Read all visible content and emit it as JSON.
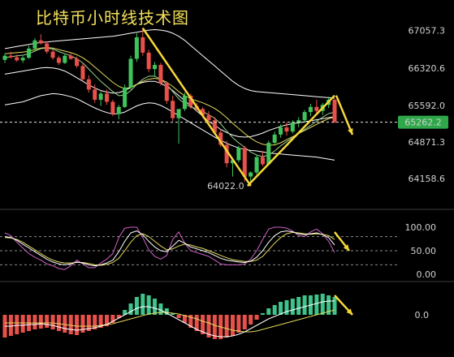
{
  "title": "比特币小时线技术图",
  "chart_data": {
    "type": "candlestick",
    "title": "比特币小时线技术图",
    "y_ticks": [
      67057.3,
      66320.6,
      65592.0,
      64871.3,
      64158.6
    ],
    "y_tick_labels": [
      "67057.3",
      "66320.6",
      "65592.0",
      "64871.3",
      "64158.6"
    ],
    "ylim": [
      63940,
      67300
    ],
    "current_price": 65262.2,
    "current_price_label": "65262.2",
    "low_annotation": {
      "value": 64022.0,
      "label": "64022.0",
      "index": 41
    },
    "candles": [
      [
        66480,
        66600,
        66420,
        66560
      ],
      [
        66560,
        66640,
        66500,
        66530
      ],
      [
        66530,
        66580,
        66440,
        66470
      ],
      [
        66470,
        66550,
        66420,
        66520
      ],
      [
        66520,
        66760,
        66500,
        66700
      ],
      [
        66700,
        66900,
        66660,
        66860
      ],
      [
        66860,
        66980,
        66780,
        66800
      ],
      [
        66800,
        66840,
        66600,
        66640
      ],
      [
        66640,
        66680,
        66480,
        66520
      ],
      [
        66520,
        66560,
        66380,
        66420
      ],
      [
        66420,
        66600,
        66400,
        66560
      ],
      [
        66560,
        66620,
        66480,
        66500
      ],
      [
        66500,
        66540,
        66320,
        66360
      ],
      [
        66360,
        66420,
        66060,
        66100
      ],
      [
        66100,
        66180,
        65840,
        65900
      ],
      [
        65900,
        66000,
        65640,
        65700
      ],
      [
        65700,
        65860,
        65580,
        65820
      ],
      [
        65820,
        65900,
        65600,
        65660
      ],
      [
        65660,
        65700,
        65380,
        65420
      ],
      [
        65420,
        65600,
        65320,
        65560
      ],
      [
        65560,
        66000,
        65540,
        65940
      ],
      [
        65940,
        66560,
        65900,
        66500
      ],
      [
        66500,
        67000,
        66440,
        66920
      ],
      [
        66920,
        67100,
        66560,
        66620
      ],
      [
        66620,
        66680,
        66240,
        66300
      ],
      [
        66300,
        66440,
        66160,
        66380
      ],
      [
        66380,
        66420,
        65980,
        66020
      ],
      [
        66020,
        66060,
        65620,
        65680
      ],
      [
        65680,
        65780,
        65280,
        65340
      ],
      [
        65340,
        65400,
        64840,
        65520
      ],
      [
        65520,
        65840,
        65480,
        65780
      ],
      [
        65780,
        65820,
        65520,
        65580
      ],
      [
        65580,
        65640,
        65460,
        65520
      ],
      [
        65520,
        65560,
        65340,
        65400
      ],
      [
        65400,
        65480,
        65240,
        65300
      ],
      [
        65300,
        65360,
        65020,
        65060
      ],
      [
        65060,
        65120,
        64780,
        64820
      ],
      [
        64820,
        64900,
        64380,
        64460
      ],
      [
        64460,
        64560,
        64200,
        64520
      ],
      [
        64520,
        64800,
        64480,
        64760
      ],
      [
        64760,
        64800,
        64100,
        64200
      ],
      [
        64200,
        64300,
        64022,
        64280
      ],
      [
        64280,
        64620,
        64240,
        64580
      ],
      [
        64580,
        64700,
        64400,
        64440
      ],
      [
        64440,
        64900,
        64420,
        64860
      ],
      [
        64860,
        65080,
        64800,
        65020
      ],
      [
        65020,
        65220,
        64960,
        65160
      ],
      [
        65160,
        65260,
        65000,
        65080
      ],
      [
        65080,
        65300,
        65040,
        65260
      ],
      [
        65260,
        65360,
        65160,
        65300
      ],
      [
        65300,
        65500,
        65260,
        65460
      ],
      [
        65460,
        65620,
        65380,
        65560
      ],
      [
        65560,
        65700,
        65420,
        65480
      ],
      [
        65480,
        65640,
        65400,
        65600
      ],
      [
        65600,
        65760,
        65540,
        65700
      ],
      [
        65700,
        65720,
        65240,
        65262.2
      ]
    ],
    "ma_series": [
      {
        "color": "#ffffff",
        "values": [
          66700,
          66720,
          66740,
          66760,
          66780,
          66800,
          66820,
          66830,
          66840,
          66850,
          66860,
          66870,
          66880,
          66890,
          66900,
          66910,
          66920,
          66930,
          66940,
          66960,
          66980,
          67000,
          67020,
          67040,
          67060,
          67070,
          67060,
          67040,
          67000,
          66940,
          66860,
          66760,
          66660,
          66560,
          66460,
          66360,
          66260,
          66160,
          66060,
          65980,
          65920,
          65880,
          65860,
          65850,
          65840,
          65830,
          65820,
          65810,
          65800,
          65790,
          65780,
          65770,
          65760,
          65750,
          65740,
          65730
        ]
      },
      {
        "color": "#ffffff",
        "values": [
          66200,
          66220,
          66240,
          66260,
          66280,
          66300,
          66320,
          66330,
          66320,
          66300,
          66260,
          66200,
          66130,
          66060,
          65990,
          65930,
          65880,
          65850,
          65830,
          65840,
          65880,
          65940,
          66000,
          66040,
          66060,
          66060,
          66020,
          65960,
          65880,
          65780,
          65680,
          65580,
          65480,
          65380,
          65280,
          65200,
          65120,
          65060,
          65010,
          64980,
          64970,
          64980,
          65010,
          65050,
          65100,
          65140,
          65180,
          65210,
          65230,
          65250,
          65270,
          65290,
          65310,
          65330,
          65350,
          65370
        ]
      },
      {
        "color": "#ffffff",
        "values": [
          65600,
          65620,
          65640,
          65660,
          65700,
          65740,
          65780,
          65800,
          65820,
          65810,
          65790,
          65760,
          65720,
          65660,
          65600,
          65540,
          65490,
          65450,
          65420,
          65430,
          65460,
          65520,
          65580,
          65620,
          65640,
          65630,
          65590,
          65530,
          65460,
          65390,
          65320,
          65250,
          65180,
          65110,
          65040,
          64970,
          64910,
          64850,
          64800,
          64760,
          64730,
          64710,
          64700,
          64680,
          64660,
          64650,
          64640,
          64630,
          64620,
          64610,
          64600,
          64590,
          64580,
          64560,
          64540,
          64520
        ]
      },
      {
        "color": "#9bd38f",
        "values": [
          66520,
          66540,
          66560,
          66570,
          66600,
          66650,
          66700,
          66710,
          66690,
          66640,
          66600,
          66560,
          66500,
          66420,
          66300,
          66180,
          66060,
          65960,
          65860,
          65780,
          65790,
          65880,
          66000,
          66100,
          66160,
          66160,
          66100,
          66000,
          65860,
          65720,
          65620,
          65560,
          65520,
          65470,
          65410,
          65340,
          65230,
          65090,
          64960,
          64860,
          64770,
          64680,
          64620,
          64590,
          64620,
          64700,
          64800,
          64880,
          64960,
          65040,
          65120,
          65200,
          65280,
          65360,
          65430,
          65460
        ]
      },
      {
        "color": "#e3d95a",
        "values": [
          66600,
          66610,
          66620,
          66630,
          66650,
          66680,
          66710,
          66720,
          66710,
          66680,
          66650,
          66620,
          66580,
          66520,
          66440,
          66340,
          66240,
          66140,
          66040,
          65960,
          65920,
          65940,
          66000,
          66060,
          66100,
          66120,
          66100,
          66040,
          65960,
          65860,
          65780,
          65720,
          65680,
          65640,
          65590,
          65530,
          65450,
          65350,
          65240,
          65140,
          65040,
          64950,
          64880,
          64830,
          64810,
          64820,
          64860,
          64920,
          64980,
          65040,
          65100,
          65160,
          65220,
          65280,
          65330,
          65360
        ]
      }
    ],
    "stoch": {
      "ylim": [
        0,
        100
      ],
      "ticks": [
        100.0,
        50.0,
        0.0
      ],
      "tick_labels": [
        "100.00",
        "50.00",
        "0.00"
      ],
      "levels": [
        80,
        50,
        20
      ],
      "k": [
        80,
        78,
        72,
        64,
        56,
        48,
        40,
        32,
        26,
        22,
        20,
        22,
        26,
        24,
        20,
        18,
        20,
        24,
        30,
        48,
        70,
        88,
        92,
        84,
        70,
        58,
        50,
        48,
        60,
        72,
        66,
        58,
        54,
        50,
        46,
        40,
        34,
        30,
        28,
        26,
        25,
        28,
        36,
        50,
        68,
        82,
        90,
        92,
        90,
        86,
        84,
        86,
        88,
        84,
        78,
        62
      ],
      "d": [
        78,
        77,
        74,
        68,
        60,
        52,
        44,
        36,
        30,
        26,
        24,
        24,
        25,
        25,
        23,
        20,
        19,
        21,
        25,
        34,
        50,
        68,
        82,
        86,
        80,
        70,
        60,
        52,
        54,
        60,
        64,
        62,
        58,
        55,
        50,
        45,
        40,
        35,
        31,
        29,
        27,
        27,
        30,
        38,
        52,
        66,
        78,
        86,
        89,
        88,
        86,
        85,
        86,
        85,
        82,
        74
      ],
      "j": [
        88,
        82,
        68,
        56,
        44,
        36,
        30,
        22,
        18,
        12,
        10,
        18,
        30,
        22,
        14,
        14,
        24,
        32,
        44,
        78,
        98,
        100,
        100,
        78,
        52,
        38,
        32,
        40,
        74,
        90,
        66,
        50,
        46,
        42,
        38,
        30,
        22,
        20,
        20,
        20,
        22,
        32,
        50,
        74,
        96,
        100,
        100,
        98,
        92,
        82,
        80,
        90,
        96,
        86,
        70,
        46
      ]
    },
    "macd": {
      "tick_labels": [
        "0.0"
      ],
      "histogram": [
        -28,
        -26,
        -24,
        -22,
        -20,
        -18,
        -17,
        -16,
        -18,
        -20,
        -22,
        -24,
        -25,
        -22,
        -20,
        -18,
        -16,
        -14,
        -10,
        -4,
        6,
        14,
        22,
        26,
        24,
        20,
        14,
        8,
        2,
        -4,
        -10,
        -16,
        -20,
        -24,
        -28,
        -30,
        -30,
        -28,
        -26,
        -22,
        -18,
        -12,
        -6,
        2,
        8,
        12,
        16,
        18,
        20,
        22,
        24,
        24,
        25,
        26,
        24,
        22
      ],
      "dif": [
        -14,
        -14,
        -13,
        -13,
        -12,
        -12,
        -11,
        -12,
        -13,
        -15,
        -17,
        -18,
        -19,
        -18,
        -17,
        -16,
        -14,
        -12,
        -8,
        -4,
        0,
        4,
        8,
        10,
        10,
        8,
        6,
        2,
        -2,
        -6,
        -10,
        -14,
        -18,
        -21,
        -24,
        -26,
        -27,
        -27,
        -26,
        -24,
        -21,
        -17,
        -13,
        -9,
        -5,
        -2,
        1,
        4,
        6,
        8,
        10,
        12,
        14,
        16,
        17,
        17
      ],
      "dea": [
        -10,
        -10,
        -10,
        -10,
        -10,
        -10,
        -10,
        -10,
        -10,
        -11,
        -12,
        -13,
        -14,
        -14,
        -14,
        -14,
        -13,
        -12,
        -11,
        -9,
        -7,
        -5,
        -3,
        -1,
        1,
        2,
        3,
        3,
        2,
        1,
        -1,
        -3,
        -5,
        -8,
        -10,
        -13,
        -15,
        -17,
        -19,
        -20,
        -21,
        -21,
        -20,
        -18,
        -16,
        -14,
        -12,
        -10,
        -8,
        -6,
        -4,
        -2,
        0,
        2,
        4,
        6
      ]
    },
    "annotations": {
      "color": "#f5d73a",
      "down_line": {
        "from_index": 23,
        "to_index": 41
      },
      "up_line": {
        "from_index": 41,
        "to_index": 55
      },
      "arrows_down_right": [
        "price",
        "stoch",
        "macd"
      ]
    }
  }
}
